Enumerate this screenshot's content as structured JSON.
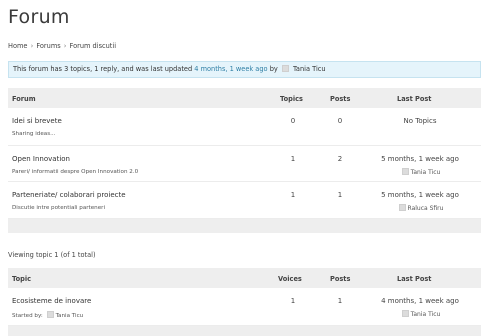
{
  "page": {
    "title": "Forum"
  },
  "breadcrumb": {
    "home": "Home",
    "forums": "Forums",
    "current": "Forum discutii",
    "separator": "›"
  },
  "notice": {
    "prefix": "This forum has 3 topics, 1 reply, and was last updated",
    "updated_link": "4 months, 1 week ago",
    "by": "by",
    "author": "Tania Ticu"
  },
  "forums_table": {
    "headers": {
      "forum": "Forum",
      "topics": "Topics",
      "posts": "Posts",
      "last_post": "Last Post"
    },
    "rows": [
      {
        "title": "Idei si brevete",
        "description": "Sharing ideas...",
        "topics": "0",
        "posts": "0",
        "last_post": "No Topics",
        "author": ""
      },
      {
        "title": "Open Innovation",
        "description": "Pareri/ informatii despre Open Innovation 2.0",
        "topics": "1",
        "posts": "2",
        "last_post": "5 months, 1 week ago",
        "author": "Tania Ticu"
      },
      {
        "title": "Parteneriate/ colaborari proiecte",
        "description": "Discutie intre potentiali parteneri",
        "topics": "1",
        "posts": "1",
        "last_post": "5 months, 1 week ago",
        "author": "Raluca Sfiru"
      }
    ]
  },
  "topics_count": "Viewing topic 1 (of 1 total)",
  "topics_table": {
    "headers": {
      "topic": "Topic",
      "voices": "Voices",
      "posts": "Posts",
      "last_post": "Last Post"
    },
    "rows": [
      {
        "title": "Ecosisteme de inovare",
        "started_by": "Started by:",
        "starter": "Tania Ticu",
        "voices": "1",
        "posts": "1",
        "last_post": "4 months, 1 week ago",
        "author": "Tania Ticu"
      }
    ]
  },
  "colors": {
    "notice_bg": "#e5f4fb",
    "link": "#2f7fa5",
    "header_bg": "#eeeeee"
  }
}
